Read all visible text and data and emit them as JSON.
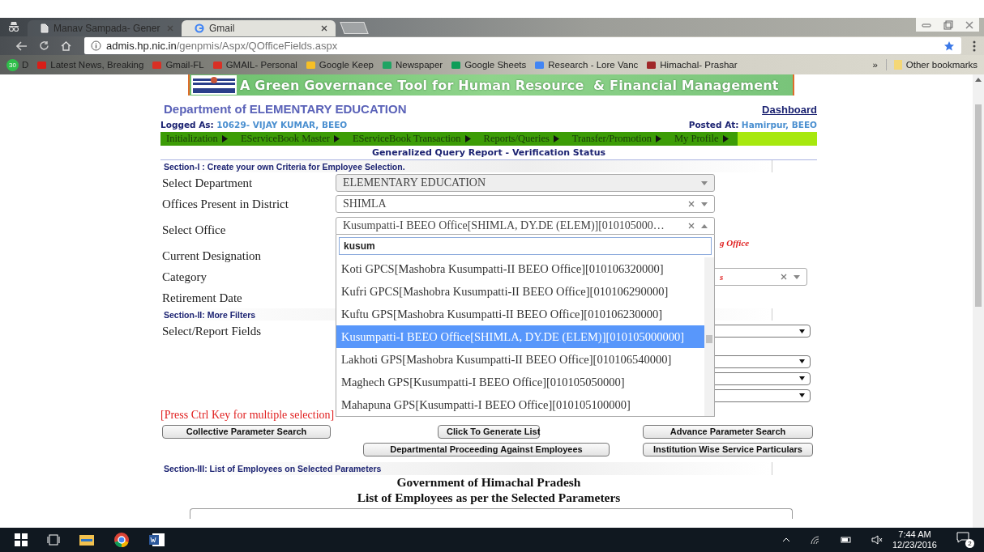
{
  "browser": {
    "tabs": [
      {
        "title": "Manav Sampada- Gener",
        "selected": false
      },
      {
        "title": "Gmail",
        "selected": true
      }
    ],
    "address": {
      "host": "admis.hp.nic.in",
      "path": "/genpmis/Aspx/QOfficeFields.aspx"
    },
    "bookmarks": [
      {
        "label": "D",
        "kind": "whatsapp",
        "badge": "30"
      },
      {
        "label": "Latest News, Breaking",
        "kind": "news"
      },
      {
        "label": "Gmail-FL",
        "kind": "gmail"
      },
      {
        "label": "GMAIL- Personal",
        "kind": "gmail"
      },
      {
        "label": "Google Keep",
        "kind": "keep"
      },
      {
        "label": "Newspaper",
        "kind": "drive"
      },
      {
        "label": "Google Sheets",
        "kind": "sheets"
      },
      {
        "label": "Research - Lore Vanc",
        "kind": "docs"
      },
      {
        "label": "Himachal- Prashar",
        "kind": "site"
      }
    ],
    "overflow": "»",
    "other_bookmarks": "Other bookmarks"
  },
  "header": {
    "banner": "A Green Governance Tool for Human Resource  & Financial Management",
    "department": "Department of ELEMENTARY EDUCATION",
    "dashboard": "Dashboard",
    "logged_label": "Logged As:",
    "logged_value": "10629- VIJAY KUMAR, BEEO",
    "posted_label": "Posted At:",
    "posted_value": "Hamirpur, BEEO"
  },
  "menu": [
    "Initialization",
    "EServiceBook Master",
    "EServiceBook Transaction",
    "Reports/Queries",
    "Transfer/Promotion",
    "My Profile"
  ],
  "report_title": "Generalized Query Report - Verification Status",
  "section_1": {
    "title": "Section-I : Create your own Criteria for Employee Selection.",
    "fields": [
      {
        "label": "Select Department",
        "kind": "select",
        "value": "ELEMENTARY EDUCATION",
        "disabled": true,
        "clearable": false,
        "expanded": false
      },
      {
        "label": "Offices Present in District",
        "kind": "select",
        "value": "SHIMLA",
        "disabled": false,
        "clearable": true,
        "expanded": false
      },
      {
        "label": "Select Office",
        "kind": "select",
        "value": "Kusumpatti-I BEEO Office[SHIMLA, DY.DE (ELEM)][010105000…",
        "disabled": false,
        "clearable": true,
        "expanded": true,
        "note": "g Office"
      },
      {
        "label": "Current Designation",
        "kind": "hidden"
      },
      {
        "label": "Category",
        "kind": "wide_select",
        "clearable": true,
        "note": "s"
      },
      {
        "label": "Retirement Date",
        "kind": "hidden"
      }
    ]
  },
  "dropdown": {
    "search": "kusum",
    "options": [
      {
        "text": "Koti GPCS[Mashobra Kusumpatti-II BEEO Office][010106320000]",
        "selected": false
      },
      {
        "text": "Kufri GPCS[Mashobra Kusumpatti-II BEEO Office][010106290000]",
        "selected": false
      },
      {
        "text": "Kuftu GPS[Mashobra Kusumpatti-II BEEO Office][010106230000]",
        "selected": false
      },
      {
        "text": "Kusumpatti-I BEEO Office[SHIMLA, DY.DE (ELEM)][010105000000]",
        "selected": true
      },
      {
        "text": "Lakhoti GPS[Mashobra Kusumpatti-II BEEO Office][010106540000]",
        "selected": false
      },
      {
        "text": "Maghech GPS[Kusumpatti-I BEEO Office][010105050000]",
        "selected": false
      },
      {
        "text": "Mahapuna GPS[Kusumpatti-I BEEO Office][010105100000]",
        "selected": false
      }
    ]
  },
  "section_2": {
    "title": "Section-II: More Filters",
    "fields": [
      {
        "label": "Select/Report Fields",
        "kind": "native_select"
      },
      {
        "kind": "native_select"
      },
      {
        "kind": "native_select"
      },
      {
        "kind": "native_select"
      }
    ]
  },
  "ctrl_hint": "[Press Ctrl Key for multiple selection]",
  "buttons": [
    {
      "label": "Collective Parameter Search",
      "kind": "left"
    },
    {
      "label": "Click To Generate List",
      "kind": "center"
    },
    {
      "label": "Advance Parameter Search",
      "kind": "right"
    },
    {
      "label": "Departmental Proceeding Against Employees",
      "kind": "center"
    },
    {
      "label": "Institution Wise Service Particulars",
      "kind": "right"
    }
  ],
  "section_3": {
    "title": "Section-III: List of Employees on Selected Parameters",
    "heading_1": "Government of Himachal Pradesh",
    "heading_2": "List of Employees as per the Selected Parameters"
  },
  "taskbar": {
    "time": "7:44 AM",
    "date": "12/23/2016",
    "notifications": "2"
  }
}
